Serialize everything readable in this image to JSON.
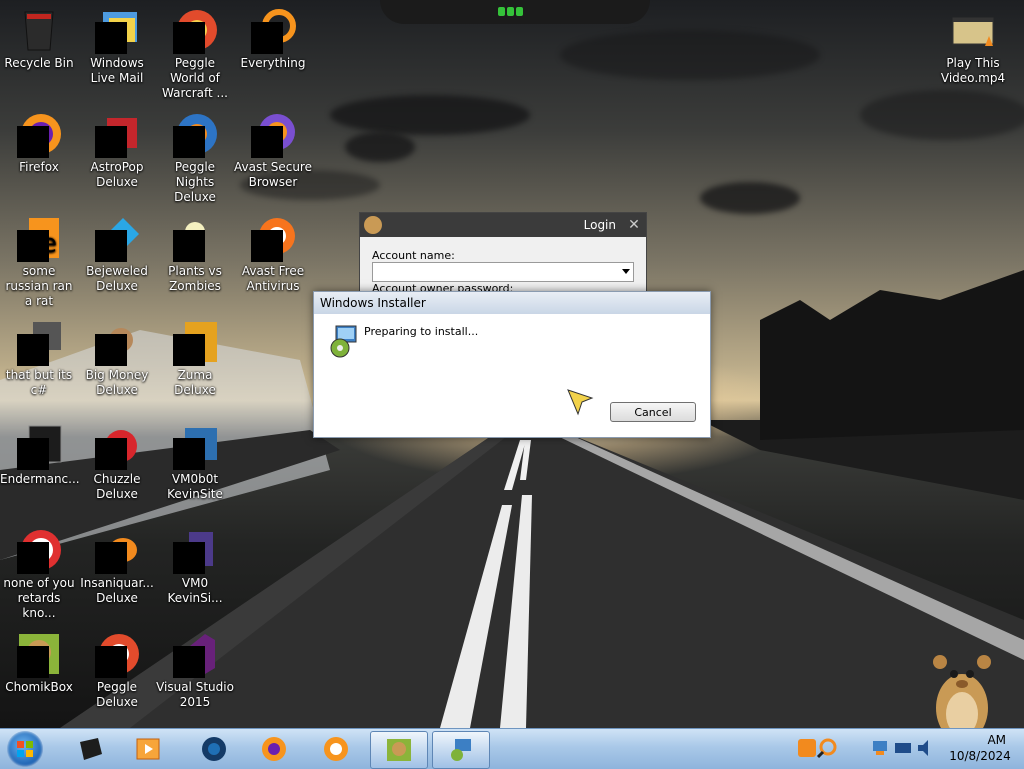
{
  "desktop_icons": [
    {
      "label": "Recycle Bin",
      "icon": "recycle-bin-icon"
    },
    {
      "label": "Windows Live Mail",
      "icon": "mail-icon"
    },
    {
      "label": "Peggle World of Warcraft ...",
      "icon": "peggle-icon"
    },
    {
      "label": "Everything",
      "icon": "search-orange-icon"
    },
    {
      "label": "Firefox",
      "icon": "firefox-icon"
    },
    {
      "label": "AstroPop Deluxe",
      "icon": "astropop-icon"
    },
    {
      "label": "Peggle Nights Deluxe",
      "icon": "peggle-nights-icon"
    },
    {
      "label": "Avast Secure Browser",
      "icon": "avast-browser-icon"
    },
    {
      "label": "some russian ran a rat",
      "icon": "generic-app-icon"
    },
    {
      "label": "Bejeweled Deluxe",
      "icon": "bejeweled-icon"
    },
    {
      "label": "Plants vs Zombies",
      "icon": "pvz-icon"
    },
    {
      "label": "Avast Free Antivirus",
      "icon": "avast-icon"
    },
    {
      "label": "that but its c#",
      "icon": "generic-app-icon"
    },
    {
      "label": "Big Money Deluxe",
      "icon": "big-money-icon"
    },
    {
      "label": "Zuma Deluxe",
      "icon": "zuma-icon"
    },
    {
      "label": "Endermanc...",
      "icon": "generic-app-icon"
    },
    {
      "label": "Chuzzle Deluxe",
      "icon": "chuzzle-icon"
    },
    {
      "label": "VM0b0t KevinSite",
      "icon": "vm-icon"
    },
    {
      "label": "none of you retards kno...",
      "icon": "generic-app-icon"
    },
    {
      "label": "Insaniquar... Deluxe",
      "icon": "insaniquarium-icon"
    },
    {
      "label": "VM0 KevinSi...",
      "icon": "vm-icon"
    },
    {
      "label": "ChomikBox",
      "icon": "chomikbox-icon"
    },
    {
      "label": "Peggle Deluxe",
      "icon": "peggle-icon"
    },
    {
      "label": "Visual Studio 2015",
      "icon": "visual-studio-icon"
    },
    {
      "label": "Play This Video.mp4",
      "icon": "video-file-icon"
    }
  ],
  "login_window": {
    "title": "Login",
    "close": "✕",
    "account_name_label": "Account name:",
    "password_label": "Account owner password:"
  },
  "installer_dialog": {
    "title": "Windows Installer",
    "message": "Preparing to install...",
    "cancel_label": "Cancel"
  },
  "taskbar": {
    "time": "AM",
    "date": "10/8/2024",
    "pinned": [
      "terminal-icon",
      "media-player-icon",
      "browser-dark-icon",
      "firefox-icon",
      "avast-browser-icon",
      "chomikbox-icon",
      "installer-icon"
    ]
  },
  "colors": {
    "taskbar": "#a9c8e8",
    "login_title": "#3b3b3b",
    "accent_orange": "#f7941d"
  }
}
